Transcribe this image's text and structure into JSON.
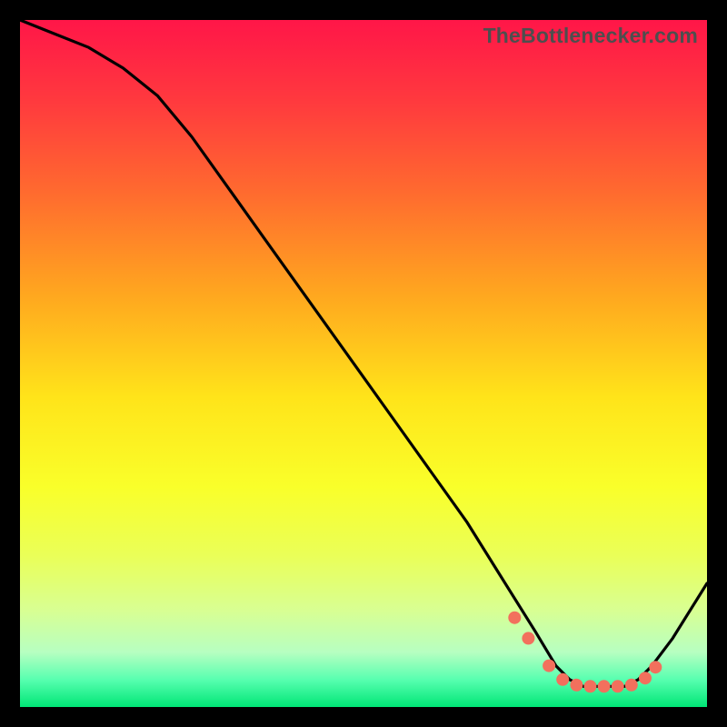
{
  "watermark": "TheBottlenecker.com",
  "chart_data": {
    "type": "line",
    "title": "",
    "xlabel": "",
    "ylabel": "",
    "xlim": [
      0,
      100
    ],
    "ylim": [
      0,
      100
    ],
    "series": [
      {
        "name": "bottleneck-curve",
        "x": [
          0,
          5,
          10,
          15,
          20,
          25,
          30,
          35,
          40,
          45,
          50,
          55,
          60,
          65,
          70,
          75,
          78,
          80,
          82,
          84,
          86,
          88,
          90,
          92,
          95,
          100
        ],
        "y": [
          100,
          98,
          96,
          93,
          89,
          83,
          76,
          69,
          62,
          55,
          48,
          41,
          34,
          27,
          19,
          11,
          6,
          4,
          3,
          3,
          3,
          3,
          4,
          6,
          10,
          18
        ]
      }
    ],
    "markers": {
      "name": "highlight-dots",
      "x": [
        72,
        74,
        77,
        79,
        81,
        83,
        85,
        87,
        89,
        91,
        92.5
      ],
      "y": [
        13,
        10,
        6,
        4,
        3.2,
        3,
        3,
        3,
        3.2,
        4.2,
        5.8
      ]
    }
  },
  "colors": {
    "curve_stroke": "#000000",
    "marker_fill": "#f2705d",
    "background_black": "#000000"
  }
}
